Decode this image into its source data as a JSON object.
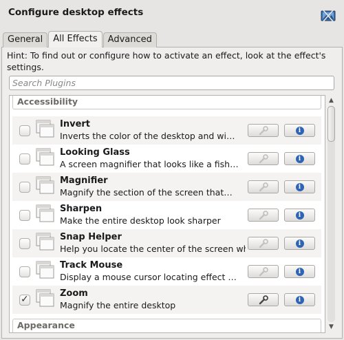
{
  "window": {
    "title": "Configure desktop effects",
    "header_icon": "desktop-effects-icon"
  },
  "tabs": [
    {
      "label": "General",
      "active": false
    },
    {
      "label": "All Effects",
      "active": true
    },
    {
      "label": "Advanced",
      "active": false
    }
  ],
  "hint": "Hint: To find out or configure how to activate an effect, look at the effect's settings.",
  "search": {
    "placeholder": "Search Plugins",
    "value": ""
  },
  "categories": {
    "accessibility": "Accessibility",
    "appearance": "Appearance"
  },
  "plugins": [
    {
      "name": "Invert",
      "description": "Inverts the color of the desktop and wi…",
      "enabled": false
    },
    {
      "name": "Looking Glass",
      "description": "A screen magnifier that looks like a fish…",
      "enabled": false
    },
    {
      "name": "Magnifier",
      "description": "Magnify the section of the screen that…",
      "enabled": false
    },
    {
      "name": "Sharpen",
      "description": "Make the entire desktop look sharper",
      "enabled": false
    },
    {
      "name": "Snap Helper",
      "description": "Help you locate the center of the screen when …",
      "enabled": false
    },
    {
      "name": "Track Mouse",
      "description": "Display a mouse cursor locating effect …",
      "enabled": false
    },
    {
      "name": "Zoom",
      "description": "Magnify the entire desktop",
      "enabled": true
    }
  ],
  "icons": {
    "configure": "wrench-icon",
    "info": "info-icon",
    "plugin": "window-stack-icon"
  },
  "colors": {
    "info_blue": "#2f64b4",
    "category_text": "#6d6b68"
  }
}
